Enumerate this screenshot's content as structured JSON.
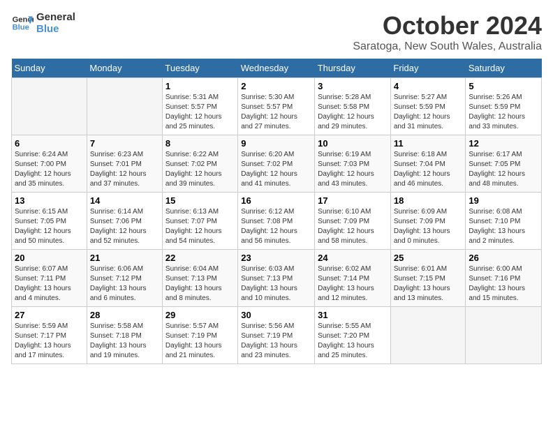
{
  "logo": {
    "line1": "General",
    "line2": "Blue"
  },
  "title": "October 2024",
  "subtitle": "Saratoga, New South Wales, Australia",
  "days_header": [
    "Sunday",
    "Monday",
    "Tuesday",
    "Wednesday",
    "Thursday",
    "Friday",
    "Saturday"
  ],
  "weeks": [
    [
      {
        "day": "",
        "info": ""
      },
      {
        "day": "",
        "info": ""
      },
      {
        "day": "1",
        "info": "Sunrise: 5:31 AM\nSunset: 5:57 PM\nDaylight: 12 hours\nand 25 minutes."
      },
      {
        "day": "2",
        "info": "Sunrise: 5:30 AM\nSunset: 5:57 PM\nDaylight: 12 hours\nand 27 minutes."
      },
      {
        "day": "3",
        "info": "Sunrise: 5:28 AM\nSunset: 5:58 PM\nDaylight: 12 hours\nand 29 minutes."
      },
      {
        "day": "4",
        "info": "Sunrise: 5:27 AM\nSunset: 5:59 PM\nDaylight: 12 hours\nand 31 minutes."
      },
      {
        "day": "5",
        "info": "Sunrise: 5:26 AM\nSunset: 5:59 PM\nDaylight: 12 hours\nand 33 minutes."
      }
    ],
    [
      {
        "day": "6",
        "info": "Sunrise: 6:24 AM\nSunset: 7:00 PM\nDaylight: 12 hours\nand 35 minutes."
      },
      {
        "day": "7",
        "info": "Sunrise: 6:23 AM\nSunset: 7:01 PM\nDaylight: 12 hours\nand 37 minutes."
      },
      {
        "day": "8",
        "info": "Sunrise: 6:22 AM\nSunset: 7:02 PM\nDaylight: 12 hours\nand 39 minutes."
      },
      {
        "day": "9",
        "info": "Sunrise: 6:20 AM\nSunset: 7:02 PM\nDaylight: 12 hours\nand 41 minutes."
      },
      {
        "day": "10",
        "info": "Sunrise: 6:19 AM\nSunset: 7:03 PM\nDaylight: 12 hours\nand 43 minutes."
      },
      {
        "day": "11",
        "info": "Sunrise: 6:18 AM\nSunset: 7:04 PM\nDaylight: 12 hours\nand 46 minutes."
      },
      {
        "day": "12",
        "info": "Sunrise: 6:17 AM\nSunset: 7:05 PM\nDaylight: 12 hours\nand 48 minutes."
      }
    ],
    [
      {
        "day": "13",
        "info": "Sunrise: 6:15 AM\nSunset: 7:05 PM\nDaylight: 12 hours\nand 50 minutes."
      },
      {
        "day": "14",
        "info": "Sunrise: 6:14 AM\nSunset: 7:06 PM\nDaylight: 12 hours\nand 52 minutes."
      },
      {
        "day": "15",
        "info": "Sunrise: 6:13 AM\nSunset: 7:07 PM\nDaylight: 12 hours\nand 54 minutes."
      },
      {
        "day": "16",
        "info": "Sunrise: 6:12 AM\nSunset: 7:08 PM\nDaylight: 12 hours\nand 56 minutes."
      },
      {
        "day": "17",
        "info": "Sunrise: 6:10 AM\nSunset: 7:09 PM\nDaylight: 12 hours\nand 58 minutes."
      },
      {
        "day": "18",
        "info": "Sunrise: 6:09 AM\nSunset: 7:09 PM\nDaylight: 13 hours\nand 0 minutes."
      },
      {
        "day": "19",
        "info": "Sunrise: 6:08 AM\nSunset: 7:10 PM\nDaylight: 13 hours\nand 2 minutes."
      }
    ],
    [
      {
        "day": "20",
        "info": "Sunrise: 6:07 AM\nSunset: 7:11 PM\nDaylight: 13 hours\nand 4 minutes."
      },
      {
        "day": "21",
        "info": "Sunrise: 6:06 AM\nSunset: 7:12 PM\nDaylight: 13 hours\nand 6 minutes."
      },
      {
        "day": "22",
        "info": "Sunrise: 6:04 AM\nSunset: 7:13 PM\nDaylight: 13 hours\nand 8 minutes."
      },
      {
        "day": "23",
        "info": "Sunrise: 6:03 AM\nSunset: 7:13 PM\nDaylight: 13 hours\nand 10 minutes."
      },
      {
        "day": "24",
        "info": "Sunrise: 6:02 AM\nSunset: 7:14 PM\nDaylight: 13 hours\nand 12 minutes."
      },
      {
        "day": "25",
        "info": "Sunrise: 6:01 AM\nSunset: 7:15 PM\nDaylight: 13 hours\nand 13 minutes."
      },
      {
        "day": "26",
        "info": "Sunrise: 6:00 AM\nSunset: 7:16 PM\nDaylight: 13 hours\nand 15 minutes."
      }
    ],
    [
      {
        "day": "27",
        "info": "Sunrise: 5:59 AM\nSunset: 7:17 PM\nDaylight: 13 hours\nand 17 minutes."
      },
      {
        "day": "28",
        "info": "Sunrise: 5:58 AM\nSunset: 7:18 PM\nDaylight: 13 hours\nand 19 minutes."
      },
      {
        "day": "29",
        "info": "Sunrise: 5:57 AM\nSunset: 7:19 PM\nDaylight: 13 hours\nand 21 minutes."
      },
      {
        "day": "30",
        "info": "Sunrise: 5:56 AM\nSunset: 7:19 PM\nDaylight: 13 hours\nand 23 minutes."
      },
      {
        "day": "31",
        "info": "Sunrise: 5:55 AM\nSunset: 7:20 PM\nDaylight: 13 hours\nand 25 minutes."
      },
      {
        "day": "",
        "info": ""
      },
      {
        "day": "",
        "info": ""
      }
    ]
  ]
}
